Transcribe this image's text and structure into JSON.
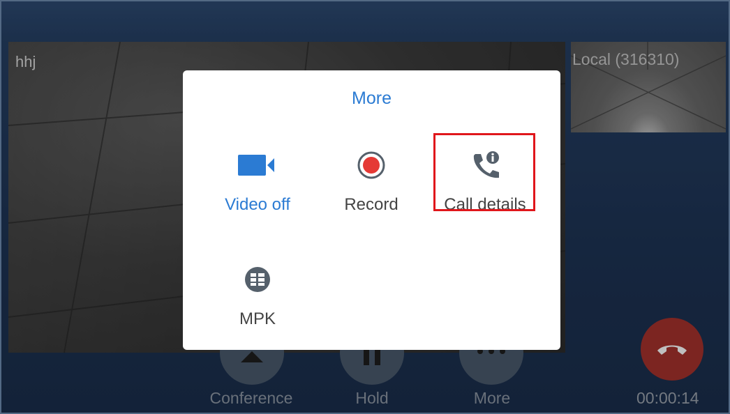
{
  "call": {
    "remote_name": "hhj",
    "local_name": "Local (316310)",
    "timer": "00:00:14"
  },
  "bottom_bar": {
    "buttons": [
      {
        "label": "Conference",
        "icon": "conference-icon"
      },
      {
        "label": "Hold",
        "icon": "pause-icon"
      },
      {
        "label": "More",
        "icon": "more-dots-icon"
      }
    ],
    "hangup_icon": "hangup-icon"
  },
  "dialog": {
    "title": "More",
    "options": [
      {
        "label": "Video off",
        "icon": "video-camera-icon",
        "color": "#2B7BD3"
      },
      {
        "label": "Record",
        "icon": "record-icon",
        "color": "#E53935"
      },
      {
        "label": "Call details",
        "icon": "call-details-icon",
        "color": "#55606B",
        "highlighted": true
      },
      {
        "label": "MPK",
        "icon": "mpk-grid-icon",
        "color": "#55606B"
      }
    ]
  },
  "colors": {
    "accent": "#2B7BD3",
    "highlight_border": "#E0161B",
    "hangup": "#A6322C"
  }
}
